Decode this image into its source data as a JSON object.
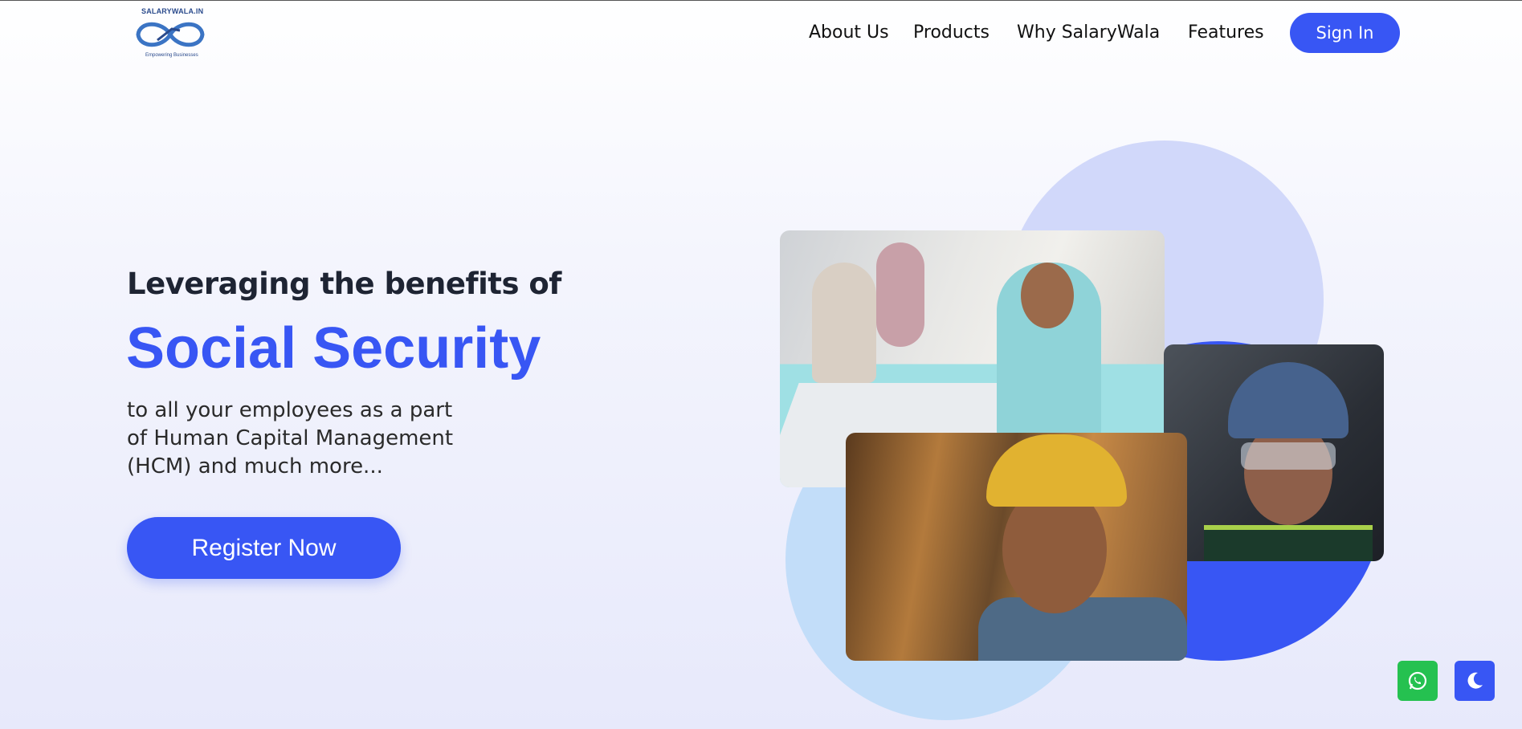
{
  "brand": {
    "name": "SALARYWALA.IN",
    "tagline": "Empowering Businesses"
  },
  "nav": {
    "items": [
      "About Us",
      "Products",
      "Why SalaryWala",
      "Features"
    ],
    "signin_label": "Sign In"
  },
  "hero": {
    "lead": "Leveraging the benefits of",
    "title": "Social Security",
    "description_lines": [
      "to all your employees as a part",
      "of Human Capital Management",
      "(HCM) and much more..."
    ],
    "cta_label": "Register Now"
  },
  "images": [
    "office-team-photo",
    "female-worker-helmet-photo",
    "construction-worker-photo"
  ],
  "floating_buttons": [
    "whatsapp-icon",
    "dark-mode-moon-icon"
  ],
  "colors": {
    "accent": "#3856f4",
    "whatsapp": "#25c150",
    "circle_light_purple": "#d1d8fa",
    "circle_light_blue": "#c2ddf9",
    "heading_dark": "#1e2433"
  }
}
